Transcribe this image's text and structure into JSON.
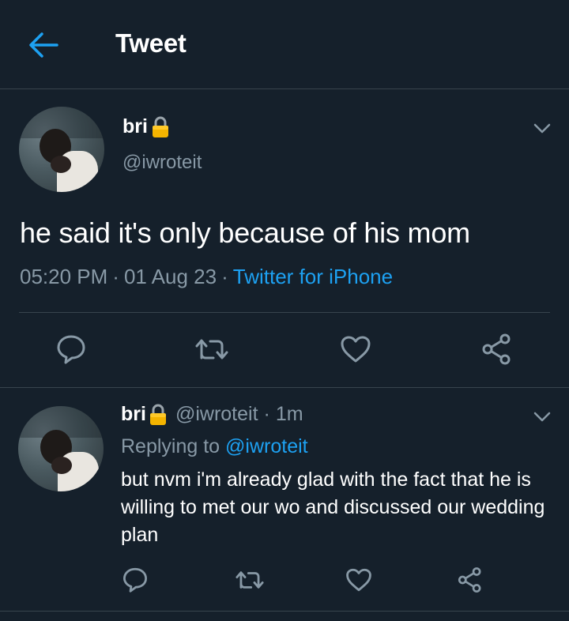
{
  "header": {
    "title": "Tweet",
    "back_icon": "arrow-left-icon"
  },
  "colors": {
    "background": "#15202b",
    "accent": "#1da1f2",
    "muted": "#8899a6",
    "divider": "#38444d",
    "lock": "#f4b400"
  },
  "tweet": {
    "display_name": "bri",
    "name_emoji": "lock-icon",
    "handle": "@iwroteit",
    "text": "he said it's only because of his mom",
    "time": "05:20 PM",
    "date": "01 Aug 23",
    "separator": "·",
    "source": "Twitter for iPhone",
    "actions": [
      "reply-icon",
      "retweet-icon",
      "like-icon",
      "share-icon"
    ]
  },
  "reply": {
    "display_name": "bri",
    "handle": "@iwroteit",
    "separator": "·",
    "time_ago": "1m",
    "replying_label": "Replying to",
    "replying_handle": "@iwroteit",
    "text": "but nvm i'm already glad with the fact that he is willing to met our wo and discussed our wedding plan",
    "actions": [
      "reply-icon",
      "retweet-icon",
      "like-icon",
      "share-icon"
    ]
  }
}
